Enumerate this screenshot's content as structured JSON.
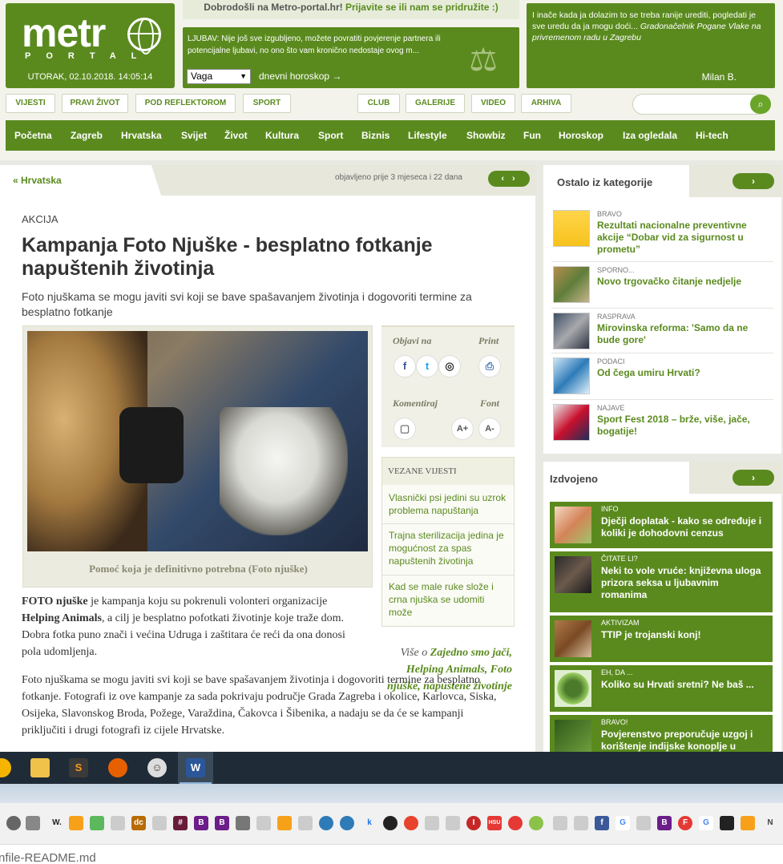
{
  "header": {
    "logo_word": "metr",
    "logo_sub": "PORTAL",
    "date_time": "UTORAK, 02.10.2018. 14:05:14",
    "welcome": "Dobrodošli na Metro-portal.hr!",
    "welcome_join": "Prijavite se ili nam se pridružite :)",
    "horoscope": {
      "text": "LJUBAV: Nije još sve izgubljeno, možete povratiti povjerenje partnera ili potencijalne ljubavi, no ono što vam kronično nedostaje ovog m...",
      "sign": "Vaga",
      "link": "dnevni horoskop →"
    },
    "quote": {
      "text": "I inače kada ja dolazim to se treba ranije urediti, pogledati je sve uredu da ja mogu doći...",
      "source": "Gradonačelnik Pogane Vlake na privremenom radu u Zagrebu",
      "author": "Milan B."
    },
    "subnav_left": [
      "VIJESTI",
      "PRAVI ŽIVOT",
      "POD REFLEKTOROM",
      "SPORT"
    ],
    "subnav_right": [
      "CLUB",
      "GALERIJE",
      "VIDEO",
      "ARHIVA"
    ],
    "search_placeholder": "",
    "mainnav": [
      "Početna",
      "Zagreb",
      "Hrvatska",
      "Svijet",
      "Život",
      "Kultura",
      "Sport",
      "Biznis",
      "Lifestyle",
      "Showbiz",
      "Fun",
      "Horoskop",
      "Iza ogledala",
      "Hi-tech"
    ]
  },
  "article": {
    "breadcrumb": "« Hrvatska",
    "published": "objavljeno prije 3 mjeseca i 22 dana",
    "kicker": "AKCIJA",
    "headline": "Kampanja Foto Njuške - besplatno fotkanje napuštenih životinja",
    "lede": "Foto njuškama se mogu javiti svi koji se bave spašavanjem životinja i dogovoriti termine za besplatno fotkanje",
    "photo_caption": "Pomoć koja je definitivno potrebna (Foto njuške)",
    "share": {
      "objavi": "Objavi na",
      "print": "Print",
      "komentiraj": "Komentiraj",
      "font": "Font",
      "font_plus": "A+",
      "font_minus": "A-",
      "facebook": "f",
      "twitter": "t"
    },
    "related_title": "VEZANE VIJESTI",
    "related": [
      "Vlasnički psi jedini su uzrok problema napuštanja",
      "Trajna sterilizacija jedina je mogućnost za spas napuštenih životinja",
      "Kad se male ruke slože i crna njuška se udomiti može"
    ],
    "more_prefix": "Više o",
    "more_tags": "Zajedno smo jači, Helping Animals, Foto njuške, napuštene životinje",
    "p1_a": "FOTO njuške",
    "p1_b": " je kampanja koju su pokrenuli volonteri organizacije ",
    "p1_c": "Helping Animals",
    "p1_d": ", a cilj je besplatno pofotkati životinje koje traže dom. Dobra fotka puno znači i većina Udruga i zaštitara će reći da ona donosi pola udomljenja.",
    "p2": "Foto njuškama se mogu javiti svi koji se bave spašavanjem životinja i dogovoriti termine za besplatno fotkanje. Fotografi iz ove kampanje za sada pokrivaju područje Grada Zagreba i okolice, Karlovca, Siska, Osijeka, Slavonskog Broda, Požege, Varaždina, Čakovca i Šibenika, a nadaju se da će se kampanji priključiti i drugi fotografi iz cijele Hrvatske."
  },
  "sidebar": {
    "other_title": "Ostalo iz kategorije",
    "other": [
      {
        "cat": "BRAVO",
        "title": "Rezultati nacionalne preventivne akcije “Dobar vid za sigurnost u prometu”"
      },
      {
        "cat": "SPORNO...",
        "title": "Novo trgovačko čitanje nedjelje"
      },
      {
        "cat": "RASPRAVA",
        "title": "Mirovinska reforma: 'Samo da ne bude gore'"
      },
      {
        "cat": "PODACI",
        "title": "Od čega umiru Hrvati?"
      },
      {
        "cat": "NAJAVE",
        "title": "Sport Fest 2018 – brže, više, jače, bogatije!"
      }
    ],
    "featured_title": "Izdvojeno",
    "featured": [
      {
        "cat": "INFO",
        "title": "Dječji doplatak - kako se određuje i koliki je dohodovni cenzus"
      },
      {
        "cat": "ČITATE LI?",
        "title": "Neki to vole vruće: književna uloga prizora seksa u ljubavnim romanima"
      },
      {
        "cat": "AKTIVIZAM",
        "title": "TTIP je trojanski konj!"
      },
      {
        "cat": "EH, DA ...",
        "title": "Koliko su Hrvati sretni? Ne baš ..."
      },
      {
        "cat": "BRAVO!",
        "title": "Povjerenstvo preporučuje uzgoj i korištenje indijske konoplje u"
      }
    ]
  },
  "taskbar": {
    "word_label": "W"
  },
  "bookmarks": [
    "W.",
    "dc",
    "#",
    "B",
    "B",
    "k",
    "I",
    "HSU",
    "f",
    "G",
    "B",
    "F",
    "G",
    "N"
  ],
  "filebar": {
    "filename": "nfile-README.md"
  }
}
